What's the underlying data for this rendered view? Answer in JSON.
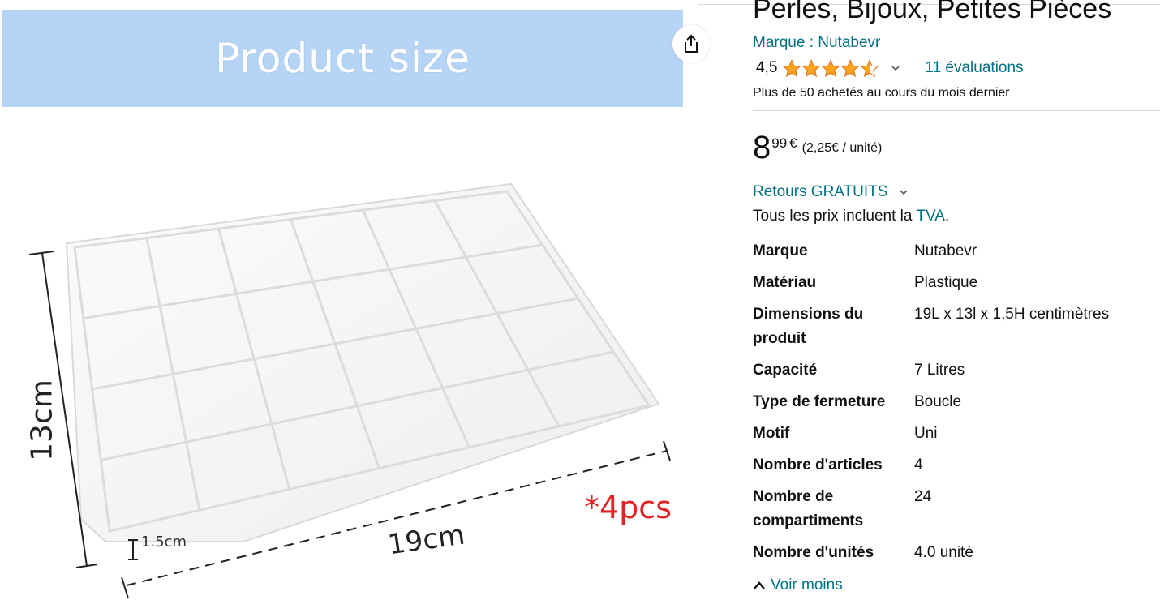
{
  "image": {
    "banner_text": "Product size",
    "dim_height": "13cm",
    "dim_width": "19cm",
    "dim_depth": "1.5cm",
    "quantity": "*4pcs"
  },
  "share": {
    "icon": "share-icon"
  },
  "product": {
    "title": "Perles, Bijoux, Petites Pièces",
    "brand_link": "Marque : Nutabevr",
    "rating_value": "4,5",
    "rating": 4.5,
    "reviews_count": "11 évaluations",
    "bought_note": "Plus de 50 achetés au cours du mois dernier",
    "price_whole": "8",
    "price_fraction": "99",
    "price_currency": "€",
    "unit_price": "(2,25€ / unité)",
    "returns_label": "Retours GRATUITS",
    "tax_prefix": "Tous les prix incluent la ",
    "tax_link": "TVA",
    "tax_suffix": ".",
    "see_less": "Voir moins"
  },
  "specs": [
    {
      "label": "Marque",
      "value": "Nutabevr"
    },
    {
      "label": "Matériau",
      "value": "Plastique"
    },
    {
      "label": "Dimensions du produit",
      "value": "19L x 13l x 1,5H centimètres"
    },
    {
      "label": "Capacité",
      "value": "7 Litres"
    },
    {
      "label": "Type de fermeture",
      "value": "Boucle"
    },
    {
      "label": "Motif",
      "value": "Uni"
    },
    {
      "label": "Nombre d'articles",
      "value": "4"
    },
    {
      "label": "Nombre de compartiments",
      "value": "24"
    },
    {
      "label": "Nombre d'unités",
      "value": "4.0 unité"
    }
  ],
  "colors": {
    "link": "#007185",
    "star": "#ffa41c",
    "banner": "#b6d5f6",
    "qty": "#e02424"
  }
}
